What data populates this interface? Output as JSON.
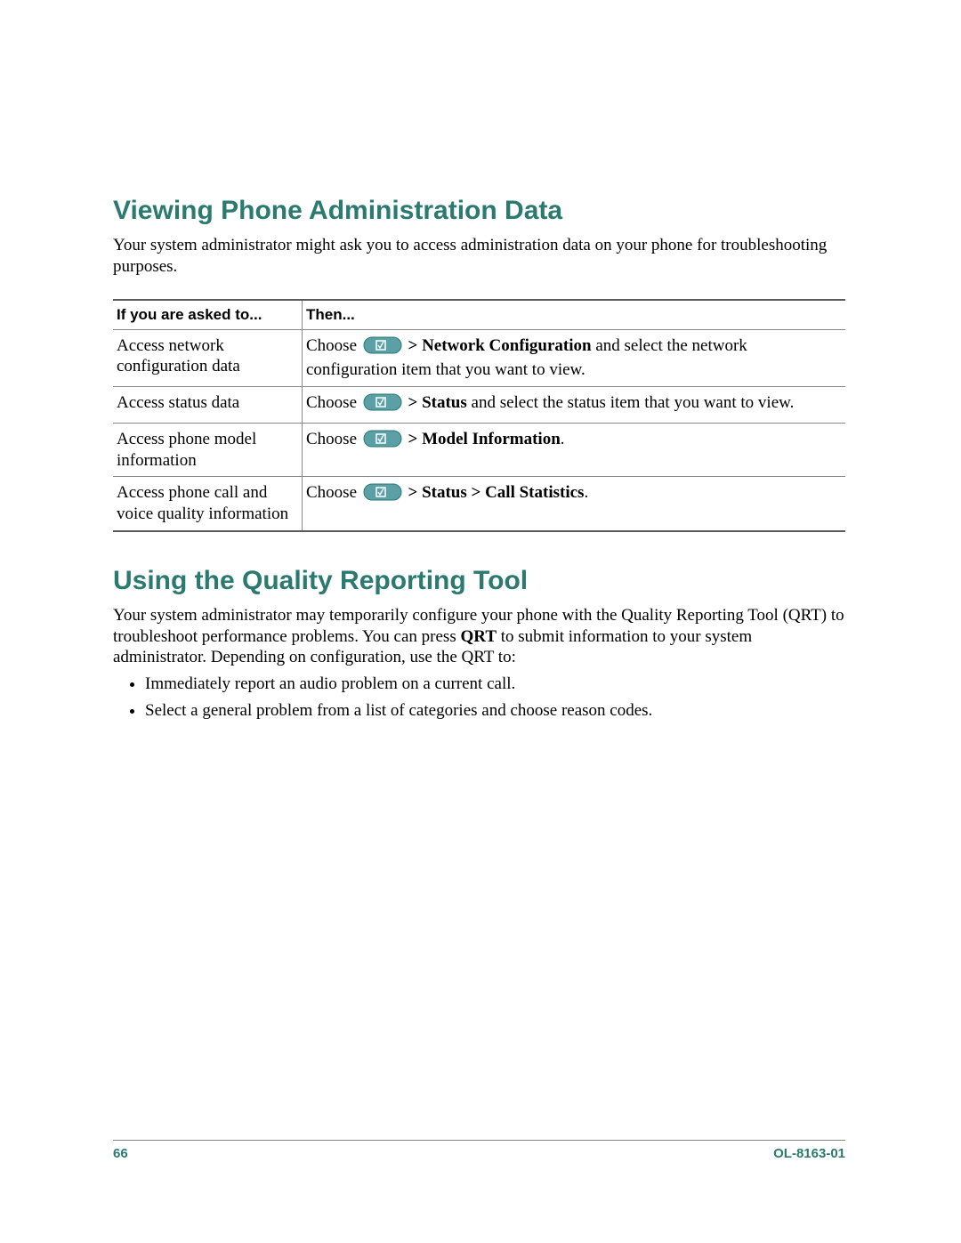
{
  "section1": {
    "title": "Viewing Phone Administration Data",
    "intro": "Your system administrator might ask you to access administration data on your phone for troubleshooting purposes."
  },
  "table": {
    "header": {
      "col1": "If you are asked to...",
      "col2": "Then..."
    },
    "rows": [
      {
        "asked": "Access network configuration data",
        "then_prefix": "Choose ",
        "then_bold": " > Network Configuration",
        "then_suffix": " and select the network configuration item that you want to view."
      },
      {
        "asked": "Access status data",
        "then_prefix": "Choose ",
        "then_bold": " > Status",
        "then_suffix": " and select the status item that you want to view."
      },
      {
        "asked": "Access phone model information",
        "then_prefix": "Choose ",
        "then_bold": " > Model Information",
        "then_suffix": "."
      },
      {
        "asked": "Access phone call and voice quality information",
        "then_prefix": "Choose ",
        "then_bold": " > Status > Call Statistics",
        "then_suffix": "."
      }
    ]
  },
  "section2": {
    "title": "Using the Quality Reporting Tool",
    "intro_pre": "Your system administrator may temporarily configure your phone with the Quality Reporting Tool (QRT) to troubleshoot performance problems. You can press ",
    "intro_bold": "QRT",
    "intro_post": " to submit information to your system administrator. Depending on configuration, use the QRT to:",
    "bullets": [
      "Immediately report an audio problem on a current call.",
      "Select a general problem from a list of categories and choose reason codes."
    ]
  },
  "footer": {
    "page": "66",
    "docid": "OL-8163-01"
  }
}
